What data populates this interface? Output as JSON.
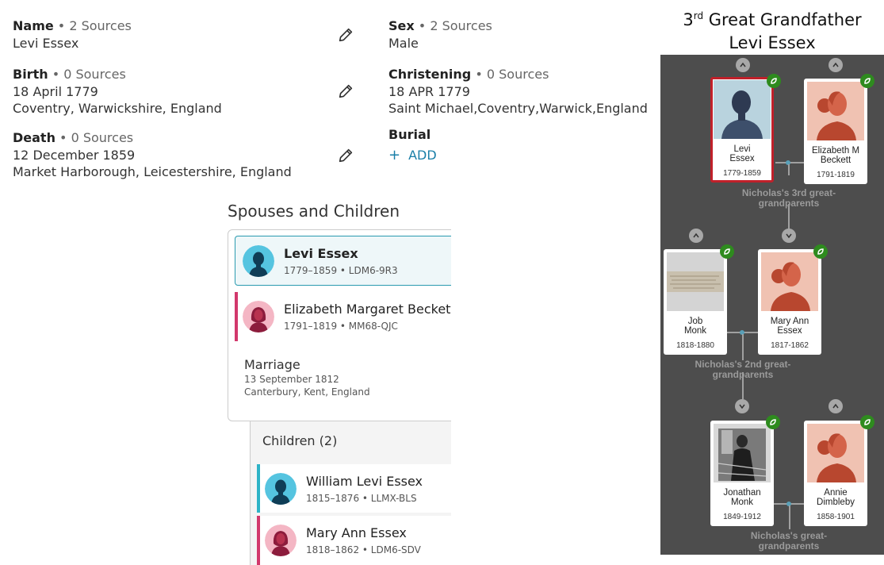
{
  "vitals": {
    "name": {
      "label": "Name",
      "sources": " • 2 Sources",
      "lines": [
        "Levi Essex"
      ]
    },
    "sex": {
      "label": "Sex",
      "sources": " • 2 Sources",
      "lines": [
        "Male"
      ]
    },
    "birth": {
      "label": "Birth",
      "sources": " • 0 Sources",
      "lines": [
        "18 April 1779",
        "Coventry, Warwickshire, England"
      ]
    },
    "christening": {
      "label": "Christening",
      "sources": " • 0 Sources",
      "lines": [
        "18 APR 1779",
        "Saint Michael,Coventry,Warwick,England"
      ]
    },
    "death": {
      "label": "Death",
      "sources": " • 0 Sources",
      "lines": [
        "12 December 1859",
        "Market Harborough, Leicestershire, England"
      ]
    },
    "burial": {
      "label": "Burial",
      "add_label": "ADD"
    }
  },
  "family": {
    "title": "Spouses and Children",
    "focus": {
      "name": "Levi Essex",
      "meta": "1779–1859 • LDM6-9R3"
    },
    "spouse": {
      "name": "Elizabeth Margaret Beckett",
      "meta": "1791–1819 • MM68-QJC"
    },
    "marriage": {
      "title": "Marriage",
      "date": "13 September 1812",
      "place": "Canterbury, Kent, England"
    },
    "children_title": "Children (2)",
    "children": [
      {
        "name": "William Levi Essex",
        "meta": "1815–1876 • LLMX-BLS"
      },
      {
        "name": "Mary Ann Essex",
        "meta": "1818–1862 • LDM6-SDV"
      }
    ]
  },
  "tree": {
    "heading_ordinal": "3",
    "heading_suffix": "rd",
    "heading_rest": " Great Grandfather",
    "heading_name": "Levi Essex",
    "cards": [
      {
        "name_l1": "Levi",
        "name_l2": "Essex",
        "dates": "1779-1859"
      },
      {
        "name_l1": "Elizabeth M",
        "name_l2": "Beckett",
        "dates": "1791-1819"
      },
      {
        "name_l1": "Job",
        "name_l2": "Monk",
        "dates": "1818-1880"
      },
      {
        "name_l1": "Mary Ann",
        "name_l2": "Essex",
        "dates": "1817-1862"
      },
      {
        "name_l1": "Jonathan",
        "name_l2": "Monk",
        "dates": "1849-1912"
      },
      {
        "name_l1": "Annie",
        "name_l2": "Dimbleby",
        "dates": "1858-1901"
      }
    ],
    "labels": [
      {
        "l1": "Nicholas's 3rd great-",
        "l2": "grandparents"
      },
      {
        "l1": "Nicholas's 2nd great-",
        "l2": "grandparents"
      },
      {
        "l1": "Nicholas's great-",
        "l2": "grandparents"
      }
    ]
  },
  "colors": {
    "accent_teal": "#2eb3c7",
    "accent_pink": "#d2386c",
    "link_blue": "#1a7fa8",
    "selected_red": "#c0202a",
    "leaf_green": "#2e8b1e",
    "tree_bg": "#4d4d4d"
  }
}
